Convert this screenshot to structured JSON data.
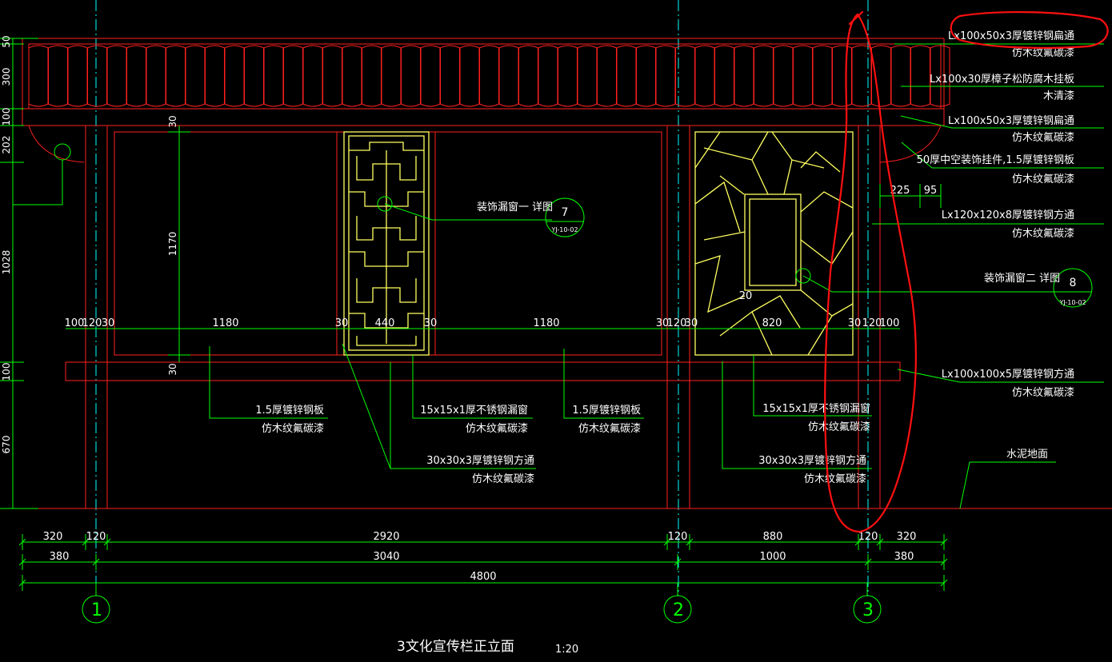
{
  "colors": {
    "background": "#000000",
    "structure": "#ff2020",
    "dimension": "#00ff00",
    "centerline": "#00ffff",
    "lattice": "#ffff60",
    "text": "#ffffff",
    "markup": "#ff1010"
  },
  "title": {
    "text": "3文化宣传栏正立面",
    "scale": "1:20"
  },
  "grid_axes": [
    "1",
    "2",
    "3"
  ],
  "detail_refs": [
    {
      "label": "装饰漏窗一  详图",
      "number": "7",
      "sheet": "YJ-10-02"
    },
    {
      "label": "装饰漏窗二  详图",
      "number": "8",
      "sheet": "YJ-10-02"
    }
  ],
  "right_notes": [
    {
      "line1": "Lx100x50x3厚镀锌钢扁通",
      "line2": "仿木纹氟碳漆"
    },
    {
      "line1": "Lx100x30厚樟子松防腐木挂板",
      "line2": "木清漆"
    },
    {
      "line1": "Lx100x50x3厚镀锌钢扁通",
      "line2": "仿木纹氟碳漆"
    },
    {
      "line1": "50厚中空装饰挂件,1.5厚镀锌钢板",
      "line2": "仿木纹氟碳漆"
    },
    {
      "line1": "Lx120x120x8厚镀锌钢方通",
      "line2": "仿木纹氟碳漆"
    },
    {
      "line1": "Lx100x100x5厚镀锌钢方通",
      "line2": "仿木纹氟碳漆"
    },
    {
      "line1": "水泥地面",
      "line2": ""
    }
  ],
  "bottom_notes": [
    {
      "line1": "1.5厚镀锌钢板",
      "line2": "仿木纹氟碳漆"
    },
    {
      "line1": "15x15x1厚不锈钢漏窗",
      "line2": "仿木纹氟碳漆"
    },
    {
      "line1": "1.5厚镀锌钢板",
      "line2": "仿木纹氟碳漆"
    },
    {
      "line1": "30x30x3厚镀锌钢方通",
      "line2": "仿木纹氟碳漆"
    },
    {
      "line1": "15x15x1厚不锈钢漏窗",
      "line2": "仿木纹氟碳漆"
    },
    {
      "line1": "30x30x3厚镀锌钢方通",
      "line2": "仿木纹氟碳漆"
    }
  ],
  "dims": {
    "left_vertical": [
      "50",
      "300",
      "100",
      "202",
      "1028",
      "100",
      "670"
    ],
    "inner_vertical": [
      "30",
      "1170",
      "30"
    ],
    "middle_row": [
      "100",
      "120",
      "30",
      "1180",
      "30",
      "440",
      "30",
      "1180",
      "30",
      "120",
      "30",
      "820",
      "30",
      "120",
      "100"
    ],
    "row1": [
      "320",
      "120",
      "2920",
      "120",
      "880",
      "120",
      "320"
    ],
    "row2": [
      "380",
      "3040",
      "1000",
      "380"
    ],
    "row3": [
      "4800"
    ],
    "side": [
      "225",
      "95"
    ],
    "marker_20": "20"
  }
}
